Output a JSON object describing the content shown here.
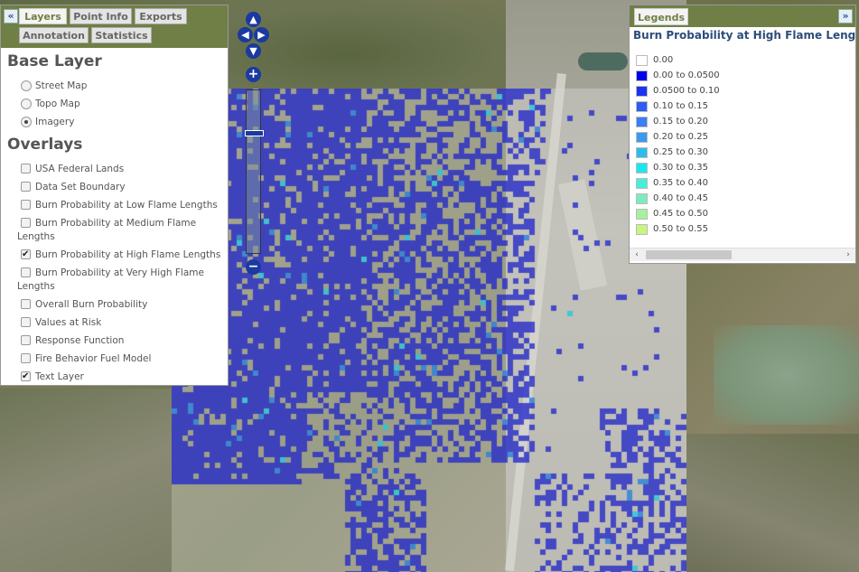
{
  "tabs": {
    "collapse": "«",
    "row1": [
      "Layers",
      "Point Info",
      "Exports"
    ],
    "row2": [
      "Annotation",
      "Statistics"
    ]
  },
  "base_layer": {
    "title": "Base Layer",
    "options": [
      {
        "label": "Street Map",
        "selected": false
      },
      {
        "label": "Topo Map",
        "selected": false
      },
      {
        "label": "Imagery",
        "selected": true
      }
    ]
  },
  "overlays": {
    "title": "Overlays",
    "items": [
      {
        "label": "USA Federal Lands",
        "checked": false
      },
      {
        "label": "Data Set Boundary",
        "checked": false
      },
      {
        "label": "Burn Probability at Low Flame Lengths",
        "checked": false
      },
      {
        "label": "Burn Probability at Medium Flame Lengths",
        "checked": false
      },
      {
        "label": "Burn Probability at High Flame Lengths",
        "checked": true
      },
      {
        "label": "Burn Probability at Very High Flame Lengths",
        "checked": false
      },
      {
        "label": "Overall Burn Probability",
        "checked": false
      },
      {
        "label": "Values at Risk",
        "checked": false
      },
      {
        "label": "Response Function",
        "checked": false
      },
      {
        "label": "Fire Behavior Fuel Model",
        "checked": false
      },
      {
        "label": "Text Layer",
        "checked": true
      }
    ]
  },
  "map_controls": {
    "pan_up": "up-arrow-icon",
    "pan_down": "down-arrow-icon",
    "pan_left": "left-arrow-icon",
    "pan_right": "right-arrow-icon",
    "zoom_in": "+",
    "zoom_out": "−"
  },
  "legend": {
    "tab": "Legends",
    "collapse": "»",
    "title": "Burn Probability at High Flame Lengt",
    "items": [
      {
        "label": "0.00",
        "color": "#ffffff"
      },
      {
        "label": "0.00 to 0.0500",
        "color": "#0000ee"
      },
      {
        "label": "0.0500 to 0.10",
        "color": "#1a33f2"
      },
      {
        "label": "0.10 to 0.15",
        "color": "#2f5cf5"
      },
      {
        "label": "0.15 to 0.20",
        "color": "#3c7ef3"
      },
      {
        "label": "0.20 to 0.25",
        "color": "#3c99ef"
      },
      {
        "label": "0.25 to 0.30",
        "color": "#2fbbec"
      },
      {
        "label": "0.30 to 0.35",
        "color": "#1de6ee"
      },
      {
        "label": "0.35 to 0.40",
        "color": "#45f0d8"
      },
      {
        "label": "0.40 to 0.45",
        "color": "#7cecc0"
      },
      {
        "label": "0.45 to 0.50",
        "color": "#a6f0a0"
      },
      {
        "label": "0.50 to 0.55",
        "color": "#c8f480"
      }
    ],
    "scroll_left": "‹",
    "scroll_right": "›"
  }
}
